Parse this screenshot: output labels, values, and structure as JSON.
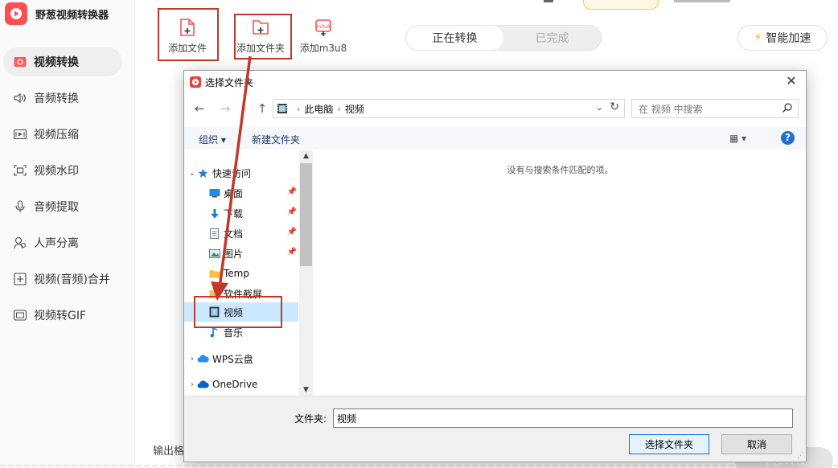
{
  "app": {
    "title": "野葱视频转换器"
  },
  "sidebar": {
    "items": [
      {
        "label": "视频转换",
        "icon": "video-convert-icon",
        "active": true
      },
      {
        "label": "音频转换",
        "icon": "audio-convert-icon"
      },
      {
        "label": "视频压缩",
        "icon": "video-compress-icon"
      },
      {
        "label": "视频水印",
        "icon": "watermark-icon"
      },
      {
        "label": "音频提取",
        "icon": "audio-extract-icon"
      },
      {
        "label": "人声分离",
        "icon": "voice-separate-icon"
      },
      {
        "label": "视频(音频)合并",
        "icon": "merge-icon"
      },
      {
        "label": "视频转GIF",
        "icon": "gif-icon"
      }
    ]
  },
  "toolbar": {
    "add_file": "添加文件",
    "add_folder": "添加文件夹",
    "add_m3u8": "添加m3u8",
    "tab_converting": "正在转换",
    "tab_done": "已完成",
    "accelerate": "智能加速"
  },
  "bottom": {
    "output_label": "输出格",
    "start_label": "全部转换"
  },
  "dialog": {
    "title": "选择文件夹",
    "address": {
      "root": "此电脑",
      "current": "视频"
    },
    "search_placeholder": "在 视频 中搜索",
    "organize": "组织 ▾",
    "new_folder": "新建文件夹",
    "empty_message": "没有与搜索条件匹配的项。",
    "tree": [
      {
        "label": "快速访问",
        "icon": "star-icon",
        "level": 0,
        "expand": "open"
      },
      {
        "label": "桌面",
        "icon": "desktop-icon",
        "level": 1,
        "pinned": true
      },
      {
        "label": "下载",
        "icon": "download-icon",
        "level": 1,
        "pinned": true
      },
      {
        "label": "文档",
        "icon": "document-icon",
        "level": 1,
        "pinned": true
      },
      {
        "label": "图片",
        "icon": "picture-icon",
        "level": 1,
        "pinned": true
      },
      {
        "label": "Temp",
        "icon": "folder-icon",
        "level": 1
      },
      {
        "label": "软件截屏",
        "icon": "folder-icon",
        "level": 1
      },
      {
        "label": "视频",
        "icon": "video-folder-icon",
        "level": 1,
        "selected": true
      },
      {
        "label": "音乐",
        "icon": "music-icon",
        "level": 1
      },
      {
        "label": "WPS云盘",
        "icon": "cloud-icon",
        "level": 0,
        "expand": "closed"
      },
      {
        "label": "OneDrive",
        "icon": "onedrive-icon",
        "level": 0,
        "expand": "closed"
      }
    ],
    "folder_label": "文件夹:",
    "folder_value": "视频",
    "select_button": "选择文件夹",
    "cancel_button": "取消"
  },
  "colors": {
    "brand": "#ff4e4e",
    "highlight": "#c0392b",
    "link": "#1f6fd1",
    "selected": "#cce8ff"
  }
}
